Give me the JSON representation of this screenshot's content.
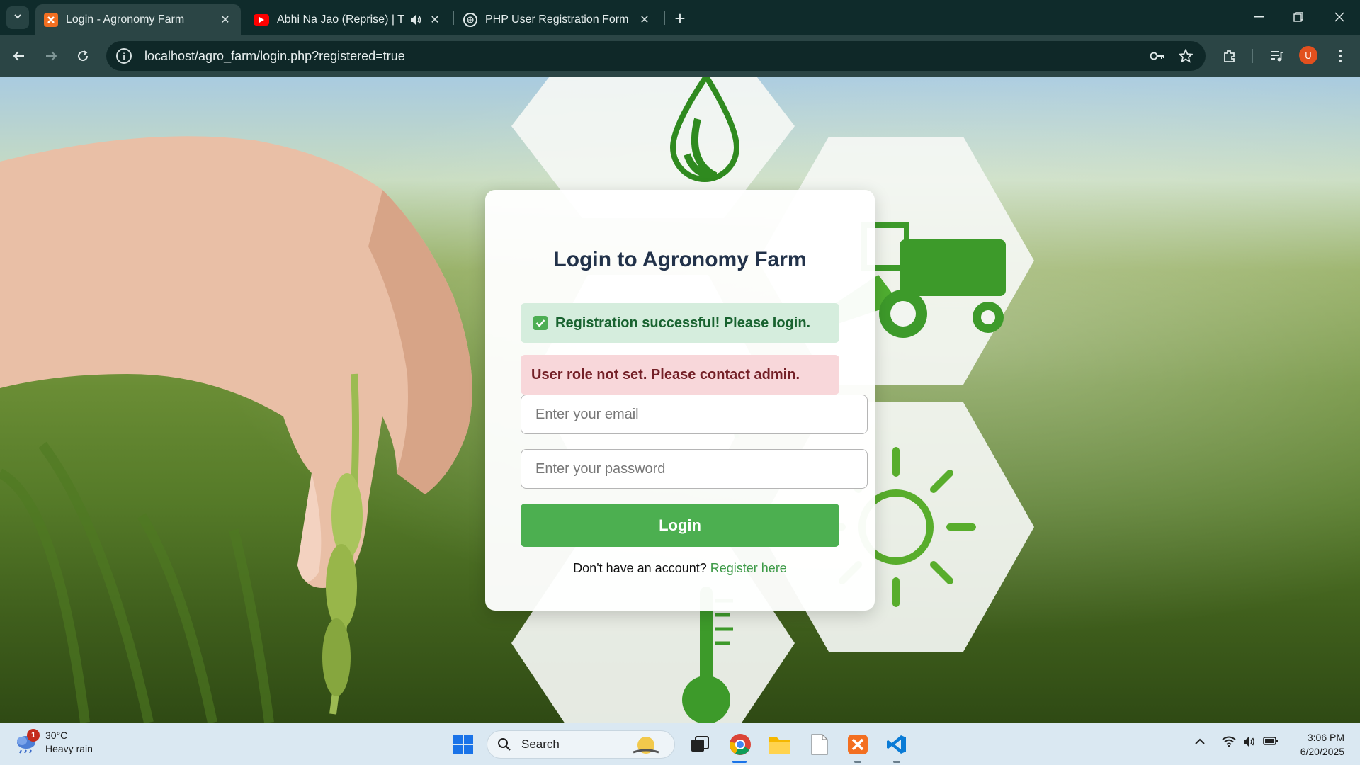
{
  "browser": {
    "tabs": [
      {
        "title": "Login - Agronomy Farm",
        "active": true,
        "icon": "xampp-icon"
      },
      {
        "title": "Abhi Na Jao (Reprise) | Twin",
        "active": false,
        "icon": "youtube-icon",
        "audio": true
      },
      {
        "title": "PHP User Registration Form",
        "active": false,
        "icon": "globe-icon"
      }
    ],
    "url": "localhost/agro_farm/login.php?registered=true",
    "profile_initial": "U"
  },
  "login": {
    "heading": "Login to Agronomy Farm",
    "success_message": "Registration successful! Please login.",
    "error_message": "User role not set. Please contact admin.",
    "email_placeholder": "Enter your email",
    "password_placeholder": "Enter your password",
    "login_button": "Login",
    "register_prompt": "Don't have an account?",
    "register_link": "Register here"
  },
  "taskbar": {
    "weather_temp": "30°C",
    "weather_desc": "Heavy rain",
    "weather_badge": "1",
    "search_label": "Search",
    "time": "3:06 PM",
    "date": "6/20/2025"
  },
  "colors": {
    "accent_green": "#4caf50",
    "success_bg": "#d5eddd",
    "error_bg": "#f8d7da",
    "link_green": "#3d9a47"
  }
}
